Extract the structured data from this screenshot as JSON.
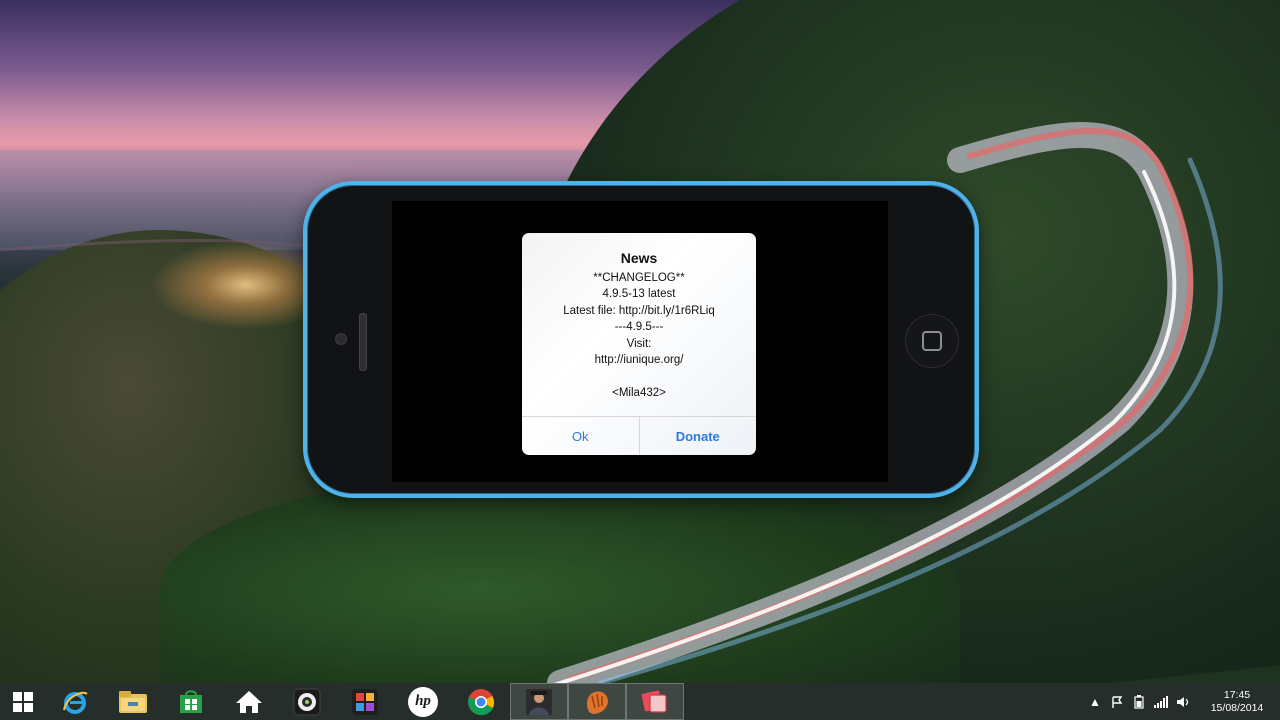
{
  "alert": {
    "title": "News",
    "lines": [
      "**CHANGELOG**",
      "4.9.5-13 latest",
      "Latest file: http://bit.ly/1r6RLiq",
      "---4.9.5---",
      "Visit:",
      "http://iunique.org/",
      "",
      "<Mila432>"
    ],
    "buttons": {
      "ok": "Ok",
      "donate": "Donate"
    }
  },
  "taskbar": {
    "apps": [
      {
        "name": "internet-explorer",
        "icon": "ie-icon"
      },
      {
        "name": "file-explorer",
        "icon": "folder-icon"
      },
      {
        "name": "windows-store",
        "icon": "store-icon"
      },
      {
        "name": "home",
        "icon": "home-icon"
      },
      {
        "name": "media-app",
        "icon": "disc-icon"
      },
      {
        "name": "photo-app",
        "icon": "colorful-icon"
      },
      {
        "name": "hp-app",
        "icon": "hp-logo-icon"
      },
      {
        "name": "chrome",
        "icon": "chrome-icon"
      },
      {
        "name": "avatar-app",
        "icon": "person-icon"
      },
      {
        "name": "baseball-app",
        "icon": "glove-icon"
      },
      {
        "name": "phone-mirror-app",
        "icon": "phone-mirror-icon"
      }
    ],
    "hp_label": "hp"
  },
  "tray": {
    "time": "17:45",
    "date": "15/08/2014"
  },
  "colors": {
    "phone_frame": "#4fb2e8",
    "alert_button": "#2f7ad6",
    "taskbar": "#121c18"
  }
}
